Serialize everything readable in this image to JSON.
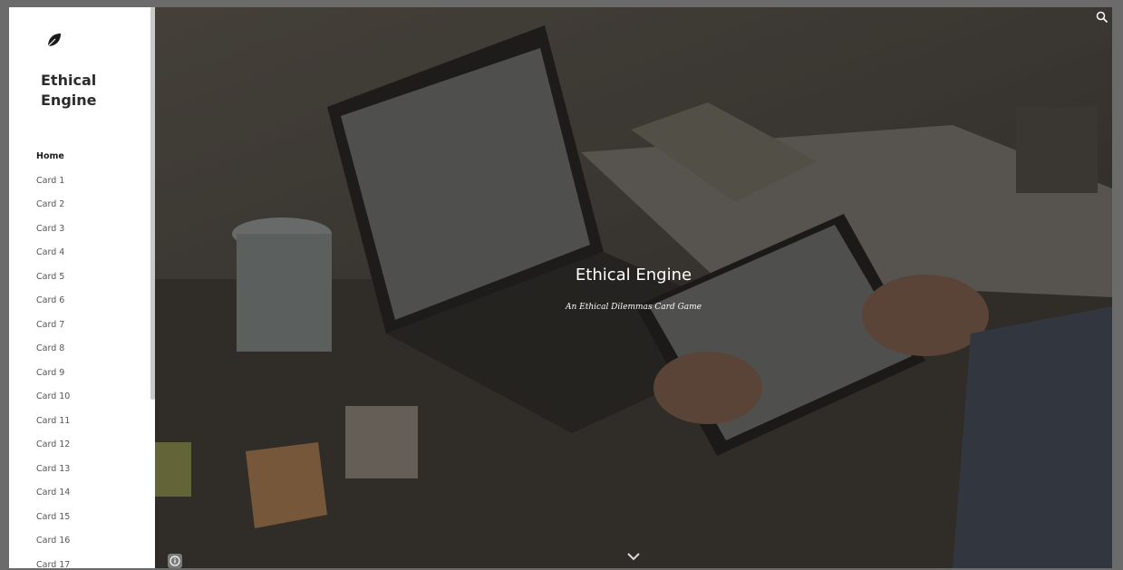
{
  "site": {
    "title": "Ethical\nEngine",
    "logo_icon": "leaf-icon"
  },
  "nav": {
    "items": [
      {
        "label": "Home",
        "active": true
      },
      {
        "label": "Card 1"
      },
      {
        "label": "Card 2"
      },
      {
        "label": "Card 3"
      },
      {
        "label": "Card 4"
      },
      {
        "label": "Card 5"
      },
      {
        "label": "Card 6"
      },
      {
        "label": "Card 7"
      },
      {
        "label": "Card 8"
      },
      {
        "label": "Card 9"
      },
      {
        "label": "Card 10"
      },
      {
        "label": "Card 11"
      },
      {
        "label": "Card 12"
      },
      {
        "label": "Card 13"
      },
      {
        "label": "Card 14"
      },
      {
        "label": "Card 15"
      },
      {
        "label": "Card 16"
      },
      {
        "label": "Card 17"
      }
    ]
  },
  "hero": {
    "title": "Ethical Engine",
    "subtitle": "An Ethical Dilemmas Card Game",
    "search_icon": "search-icon",
    "info_icon": "info-icon",
    "scroll_icon": "chevron-down-icon"
  },
  "colors": {
    "sidebar_bg": "#ffffff",
    "hero_text": "#ffffff",
    "nav_text": "#555555"
  }
}
